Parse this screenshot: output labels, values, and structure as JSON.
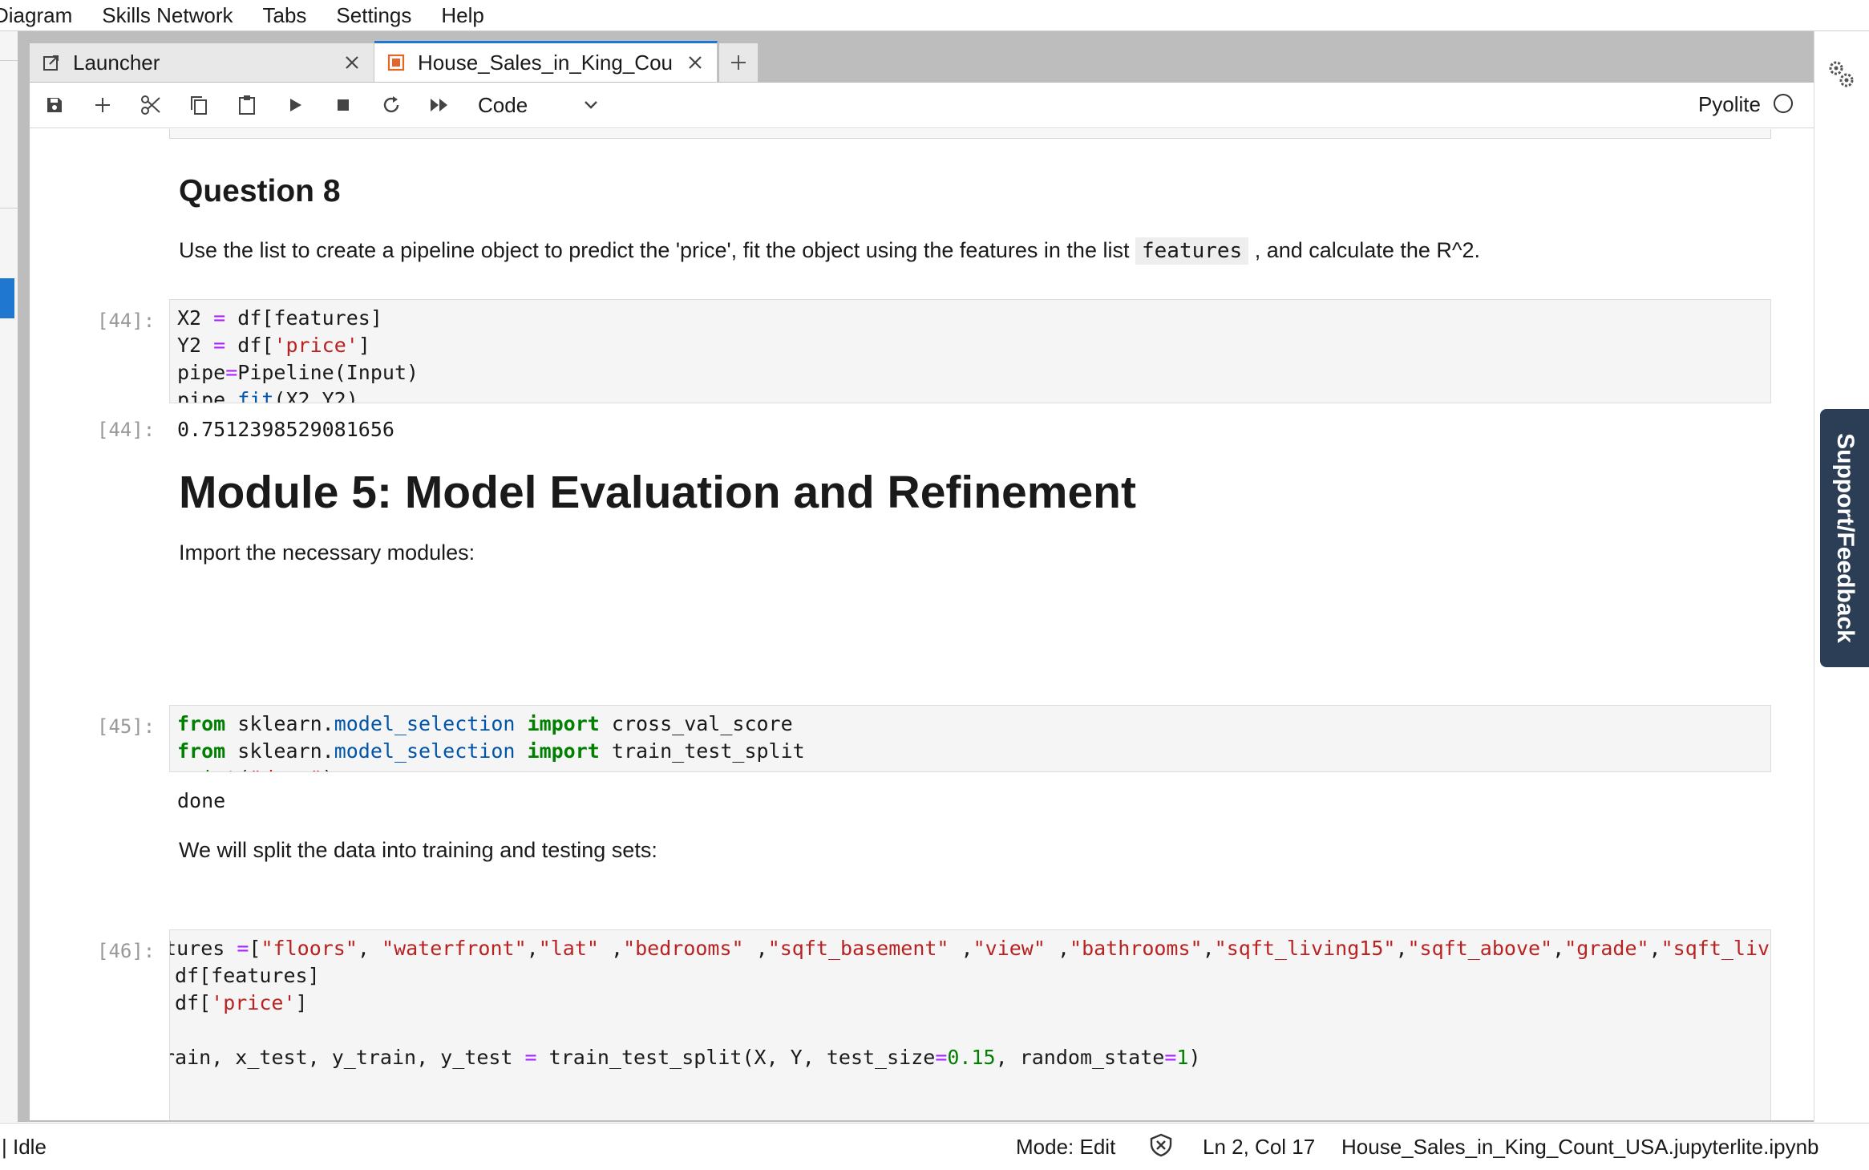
{
  "menu": [
    "Diagram",
    "Skills Network",
    "Tabs",
    "Settings",
    "Help"
  ],
  "tabs": {
    "launcher_label": "Launcher",
    "notebook_label": "House_Sales_in_King_Cou"
  },
  "toolbar": {
    "cell_type": "Code",
    "kernel_name": "Pyolite"
  },
  "cells": {
    "q8_heading": "Question 8",
    "q8_text_before": "Use the list to create a pipeline object to predict the 'price', fit the object using the features in the list ",
    "q8_code_term": "features",
    "q8_text_after": " , and calculate the R^2.",
    "c44_prompt": "[44]:",
    "c44_out_prompt": "[44]:",
    "c44_output": "0.7512398529081656",
    "module5_heading": "Module 5: Model Evaluation and Refinement",
    "import_text": "Import the necessary modules:",
    "c45_prompt": "[45]:",
    "c45_output": "done",
    "split_text": "We will split the data into training and testing sets:",
    "c46_prompt": "[46]:"
  },
  "right_sidebar": {
    "support_label": "Support/Feedback"
  },
  "statusbar": {
    "kernel_state": "| Idle",
    "mode": "Mode: Edit",
    "cursor_pos": "Ln 2, Col 17",
    "filename": "House_Sales_in_King_Count_USA.jupyterlite.ipynb"
  },
  "colors": {
    "accent": "#1f77d0",
    "keyword": "#008000",
    "string": "#ba2121",
    "operator": "#aa22ff",
    "function": "#0055aa",
    "support_bg": "#2c3e56"
  }
}
